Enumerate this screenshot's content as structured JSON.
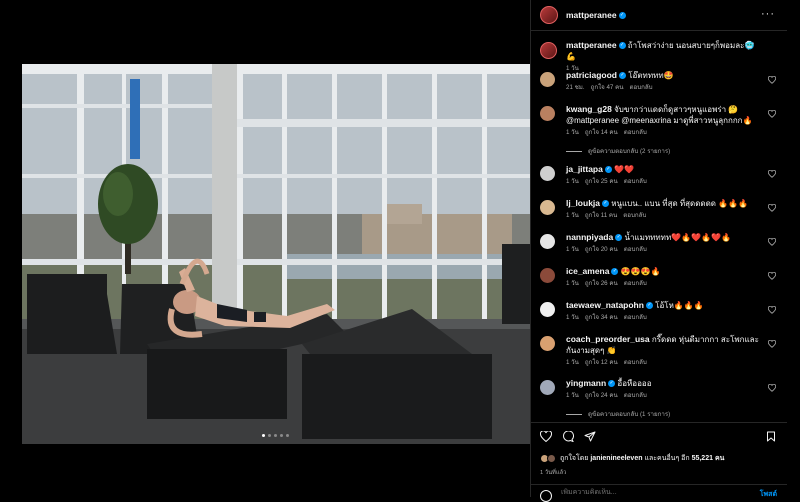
{
  "post": {
    "username": "mattperanee",
    "caption_text": "ถ้าโพสว่าง่าย นอนสบายๆก็พอมละ🥶 💪",
    "caption_time": "1 วัน",
    "carousel_total": 5,
    "carousel_active": 1,
    "likes_prefix": "ถูกใจโดย",
    "liked_by": "janienineeleven",
    "likes_middle": "และคนอื่นๆ อีก",
    "likes_count": "55,221",
    "likes_suffix": "คน",
    "date": "1 วันที่แล้ว",
    "add_comment_placeholder": "เพิ่มความคิดเห็น...",
    "post_label": "โพสต์"
  },
  "comments": [
    {
      "user": "patriciagood",
      "verified": true,
      "text": "โอ๊ตทททท🤩",
      "time": "21 ชม.",
      "likes": "ถูกใจ 47 คน",
      "reply": "ตอบกลับ",
      "avatar": "#c9a27a"
    },
    {
      "user": "kwang_g28",
      "verified": false,
      "text": "จับขากว่าแดดก็ดูสาวๆหนูแอพร่า 🤔 @mattperanee @meenaxrina มาดูพี่สาวหนูลุกกกก🔥",
      "time": "1 วัน",
      "likes": "ถูกใจ 14 คน",
      "reply": "ตอบกลับ",
      "avatar": "#b98060",
      "view_replies": "ดูข้อความตอบกลับ (2 รายการ)"
    },
    {
      "user": "ja_jittapa",
      "verified": true,
      "text": "❤️❤️",
      "time": "1 วัน",
      "likes": "ถูกใจ 25 คน",
      "reply": "ตอบกลับ",
      "avatar": "#cfcfcf"
    },
    {
      "user": "lj_loukja",
      "verified": true,
      "text": "หนูแบน.. แบน ที่สุด ที่สุดดดดด 🔥🔥🔥",
      "time": "1 วัน",
      "likes": "ถูกใจ 11 คน",
      "reply": "ตอบกลับ",
      "avatar": "#d8b890"
    },
    {
      "user": "nannpiyada",
      "verified": true,
      "text": "น้ำแมททททท❤️🔥❤️🔥❤️🔥",
      "time": "1 วัน",
      "likes": "ถูกใจ 20 คน",
      "reply": "ตอบกลับ",
      "avatar": "#e6e6e6"
    },
    {
      "user": "ice_amena",
      "verified": true,
      "text": "😍😍😍🔥",
      "time": "1 วัน",
      "likes": "ถูกใจ 26 คน",
      "reply": "ตอบกลับ",
      "avatar": "#8b4a3a"
    },
    {
      "user": "taewaew_natapohn",
      "verified": true,
      "text": "โอ้โห🔥🔥🔥",
      "time": "1 วัน",
      "likes": "ถูกใจ 34 คน",
      "reply": "ตอบกลับ",
      "avatar": "#f0f0f0"
    },
    {
      "user": "coach_preorder_usa",
      "verified": false,
      "text": "กรี๊ดดด หุ่นดีมากกา สะโพกและกันงามสุดๆ 👏",
      "time": "1 วัน",
      "likes": "ถูกใจ 12 คน",
      "reply": "ตอบกลับ",
      "avatar": "#d9a070"
    },
    {
      "user": "yingmann",
      "verified": true,
      "text": "อื้อหืออออ",
      "time": "1 วัน",
      "likes": "ถูกใจ 24 คน",
      "reply": "ตอบกลับ",
      "avatar": "#a0a8b8",
      "view_replies": "ดูข้อความตอบกลับ (1 รายการ)"
    }
  ],
  "colors": {
    "background": "#000000",
    "text": "#f5f5f5",
    "muted": "#a8a8a8",
    "verified": "#0095f6",
    "divider": "#262626"
  }
}
